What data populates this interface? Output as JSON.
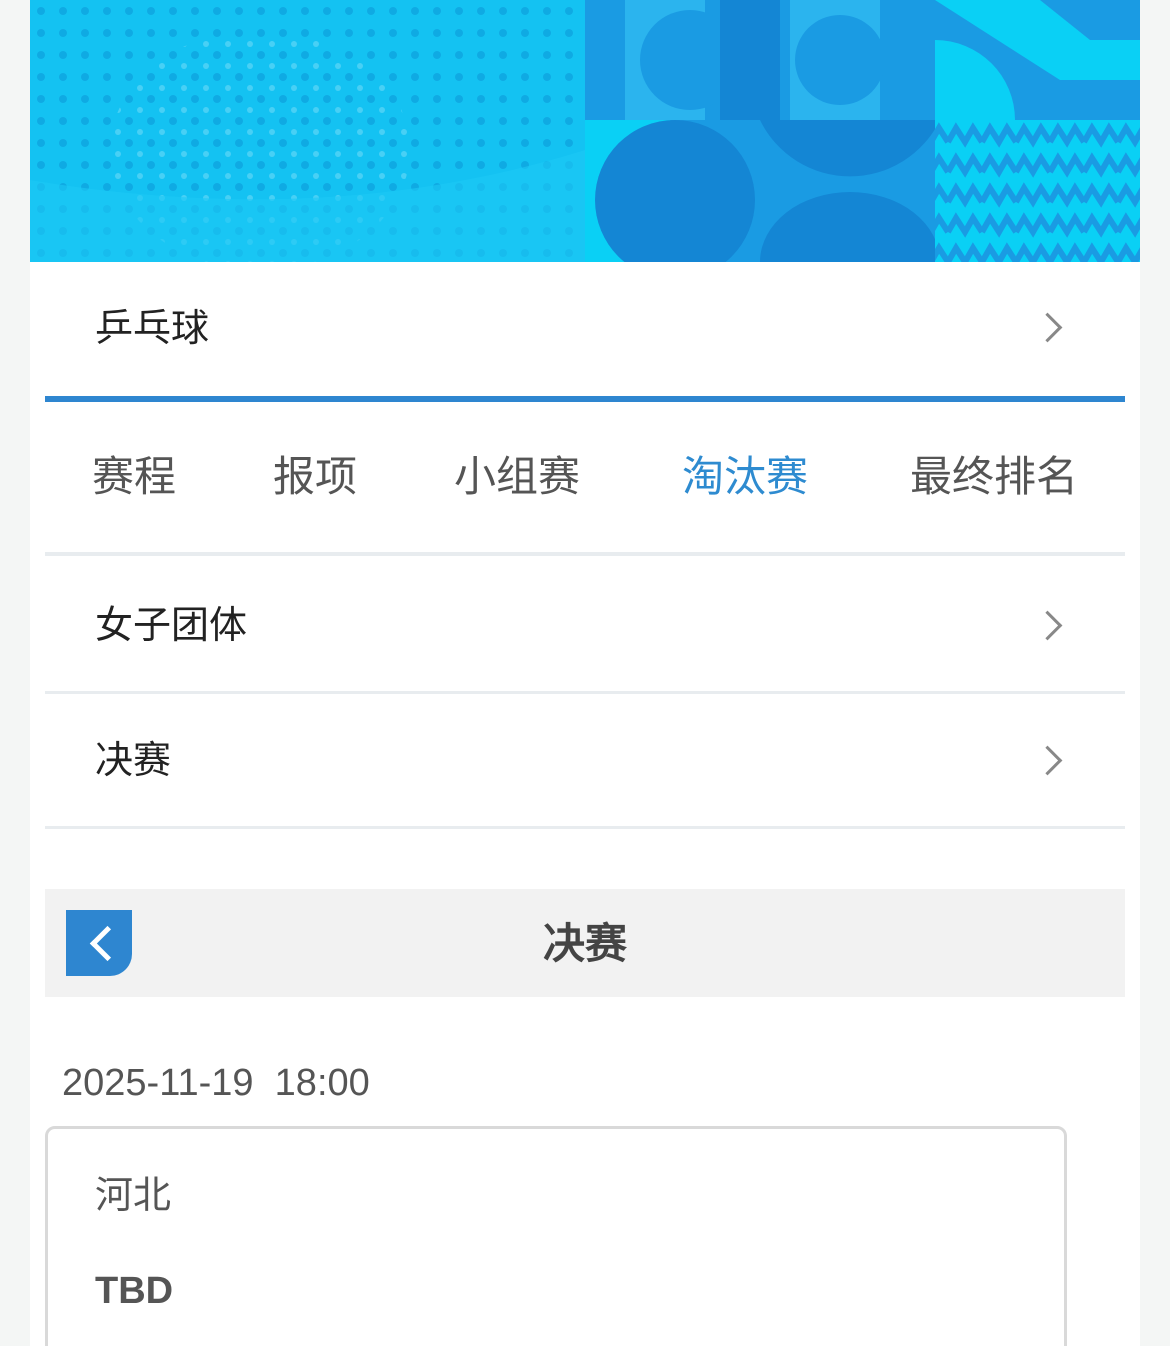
{
  "sport": {
    "label": "乒乓球"
  },
  "tabs": [
    {
      "label": "赛程"
    },
    {
      "label": "报项"
    },
    {
      "label": "小组赛"
    },
    {
      "label": "淘汰赛"
    },
    {
      "label": "最终排名"
    }
  ],
  "event": {
    "label": "女子团体"
  },
  "round": {
    "label": "决赛"
  },
  "stage": {
    "title": "决赛"
  },
  "match": {
    "datetime": "2025-11-19  18:00",
    "team1": "河北",
    "team2": "TBD"
  },
  "colors": {
    "accent": "#2e86d0",
    "banner_light": "#14c2f2",
    "banner_dark": "#1a9be3"
  },
  "icons": {
    "chevron": "chevron-right-icon",
    "back": "back-arrow-icon"
  }
}
